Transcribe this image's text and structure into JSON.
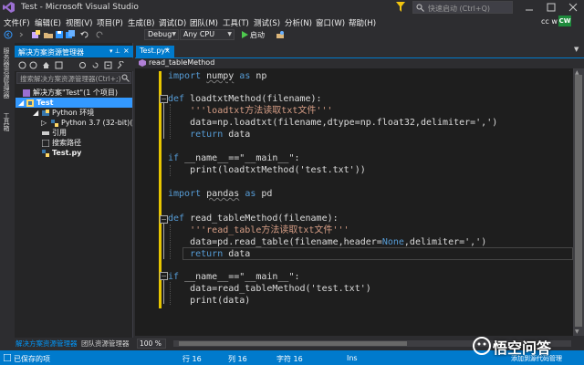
{
  "window": {
    "title": "Test - Microsoft Visual Studio",
    "quick_launch_placeholder": "快速启动 (Ctrl+Q)"
  },
  "menu": [
    "文件(F)",
    "编辑(E)",
    "视图(V)",
    "项目(P)",
    "生成(B)",
    "调试(D)",
    "团队(M)",
    "工具(T)",
    "测试(S)",
    "分析(N)",
    "窗口(W)",
    "帮助(H)"
  ],
  "account": {
    "user": "cc w",
    "badge": "CW",
    "badge_color": "#1e8a3c"
  },
  "toolbar": {
    "config": "Debug",
    "platform": "Any CPU",
    "start_label": "启动"
  },
  "left_tabs": [
    "服务器资源管理器",
    "工具箱"
  ],
  "solution_explorer": {
    "title": "解决方案资源管理器",
    "search_placeholder": "搜索解决方案资源管理器(Ctrl+;)",
    "tree": [
      {
        "label": "解决方案\"Test\"(1 个项目)",
        "level": 0,
        "icon": "solution-icon"
      },
      {
        "label": "Test",
        "level": 1,
        "icon": "python-project-icon",
        "selected": true
      },
      {
        "label": "Python 环境",
        "level": 2,
        "icon": "python-env-icon"
      },
      {
        "label": "Python 3.7 (32-bit)(全局默认)",
        "level": 3,
        "icon": "python-icon"
      },
      {
        "label": "引用",
        "level": 2,
        "icon": "references-icon"
      },
      {
        "label": "搜索路径",
        "level": 2,
        "icon": "search-path-icon"
      },
      {
        "label": "Test.py",
        "level": 2,
        "icon": "py-file-icon"
      }
    ]
  },
  "bottom_tabs": [
    "解决方案资源管理器",
    "团队资源管理器"
  ],
  "editor": {
    "tab": "Test.py*",
    "nav_member": "read_tableMethod",
    "zoom": "100 %",
    "code": [
      [
        "import",
        " ",
        "numpy",
        " ",
        "as",
        " np"
      ],
      [
        "def",
        " loadtxtMethod(filename):"
      ],
      [
        "    ",
        "'''loadtxt方法读取txt文件'''"
      ],
      [
        "    data=np.loadtxt(filename,dtype=np.float32,delimiter=',')"
      ],
      [
        "    ",
        "return",
        " data"
      ],
      [
        "if",
        " __name__==\"__main__\":"
      ],
      [
        "    print(loadtxtMethod('test.txt'))"
      ],
      [
        "import",
        " ",
        "pandas",
        " ",
        "as",
        " pd"
      ],
      [
        "def",
        " read_tableMethod(filename):"
      ],
      [
        "    ",
        "'''read_table方法读取txt文件'''"
      ],
      [
        "    data=pd.read_table(filename,header=",
        "None",
        ",delimiter=',')"
      ],
      [
        "    ",
        "return",
        " data"
      ],
      [
        "if",
        " __name__==\"__main__\":"
      ],
      [
        "    data=read_tableMethod('test.txt')"
      ],
      [
        "    print(data)"
      ]
    ]
  },
  "status": {
    "saved": "已保存的项",
    "line": "行 16",
    "col": "列 16",
    "char": "字符 16",
    "mode": "Ins",
    "source_control": "添加到源代码管理"
  },
  "watermark": "悟空问答"
}
